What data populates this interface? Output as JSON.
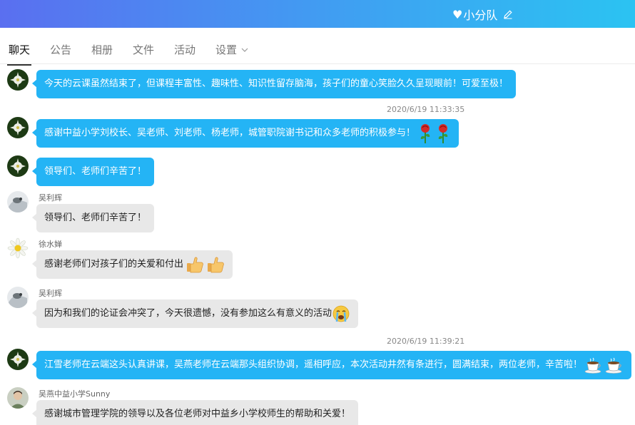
{
  "header": {
    "group_name": "小分队",
    "heart_icon": "heart-icon",
    "edit_icon": "edit-icon"
  },
  "tabs": [
    {
      "label": "聊天",
      "active": true
    },
    {
      "label": "公告"
    },
    {
      "label": "相册"
    },
    {
      "label": "文件"
    },
    {
      "label": "活动"
    },
    {
      "label": "设置",
      "has_dropdown": true
    }
  ],
  "messages": [
    {
      "kind": "self",
      "text": "今天的云课虽然结束了，但课程丰富性、趣味性、知识性留存脑海，孩子们的童心笑脸久久呈现眼前！可爱至极！"
    },
    {
      "kind": "time",
      "text": "2020/6/19 11:33:35"
    },
    {
      "kind": "self",
      "text": "感谢中益小学刘校长、吴老师、刘老师、杨老师，城管职院谢书记和众多老师的积极参与！",
      "emoji": [
        "rose-emoji",
        "rose-emoji"
      ]
    },
    {
      "kind": "self",
      "text": "领导们、老师们辛苦了！"
    },
    {
      "kind": "other",
      "sender": "吴利辉",
      "text": "领导们、老师们辛苦了！"
    },
    {
      "kind": "other",
      "sender": "徐水婵",
      "text": "感谢老师们对孩子们的关爱和付出",
      "emoji": [
        "thumbs-up-emoji",
        "thumbs-up-emoji"
      ]
    },
    {
      "kind": "other",
      "sender": "吴利辉",
      "text": "因为和我们的论证会冲突了，今天很遗憾，没有参加这么有意义的活动",
      "emoji": [
        "crying-emoji"
      ]
    },
    {
      "kind": "time",
      "text": "2020/6/19 11:39:21"
    },
    {
      "kind": "self",
      "text": "江雪老师在云端这头认真讲课，吴燕老师在云端那头组织协调，遥相呼应，本次活动井然有条进行，圆满结束，两位老师，辛苦啦！",
      "emoji": [
        "coffee-emoji",
        "coffee-emoji"
      ]
    },
    {
      "kind": "other",
      "sender": "吴燕中益小学Sunny",
      "text": "感谢城市管理学院的领导以及各位老师对中益乡小学校师生的帮助和关爱！"
    }
  ],
  "colors": {
    "self_bubble": "#24b4f5",
    "other_bubble": "#e8e8e8",
    "header_start": "#5a6ff0",
    "header_end": "#2bc3f2"
  }
}
